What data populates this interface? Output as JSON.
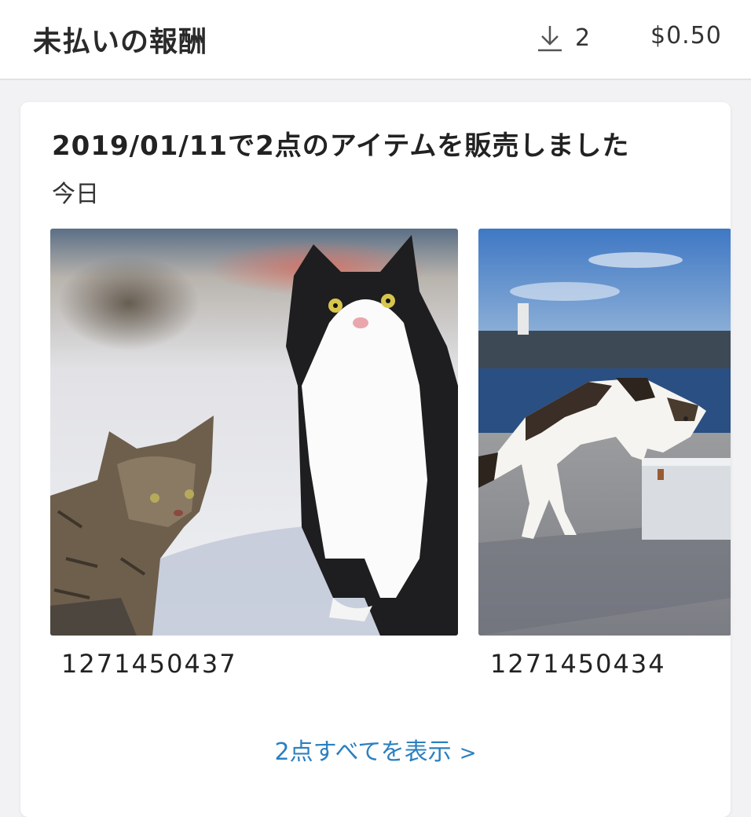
{
  "header": {
    "title": "未払いの報酬",
    "download_count": "2",
    "amount": "$0.50",
    "download_icon": "download-icon"
  },
  "card": {
    "title": "2019/01/11で2点のアイテムを販売しました",
    "date_label": "今日",
    "items": [
      {
        "id": "1271450437",
        "image": "two-cats-photo"
      },
      {
        "id": "1271450434",
        "image": "cat-on-pier-photo"
      }
    ],
    "show_all_label": "2点すべてを表示",
    "show_all_chevron": ">"
  },
  "colors": {
    "link": "#2b80c0",
    "background": "#f2f2f4",
    "card": "#ffffff",
    "text": "#222222"
  }
}
